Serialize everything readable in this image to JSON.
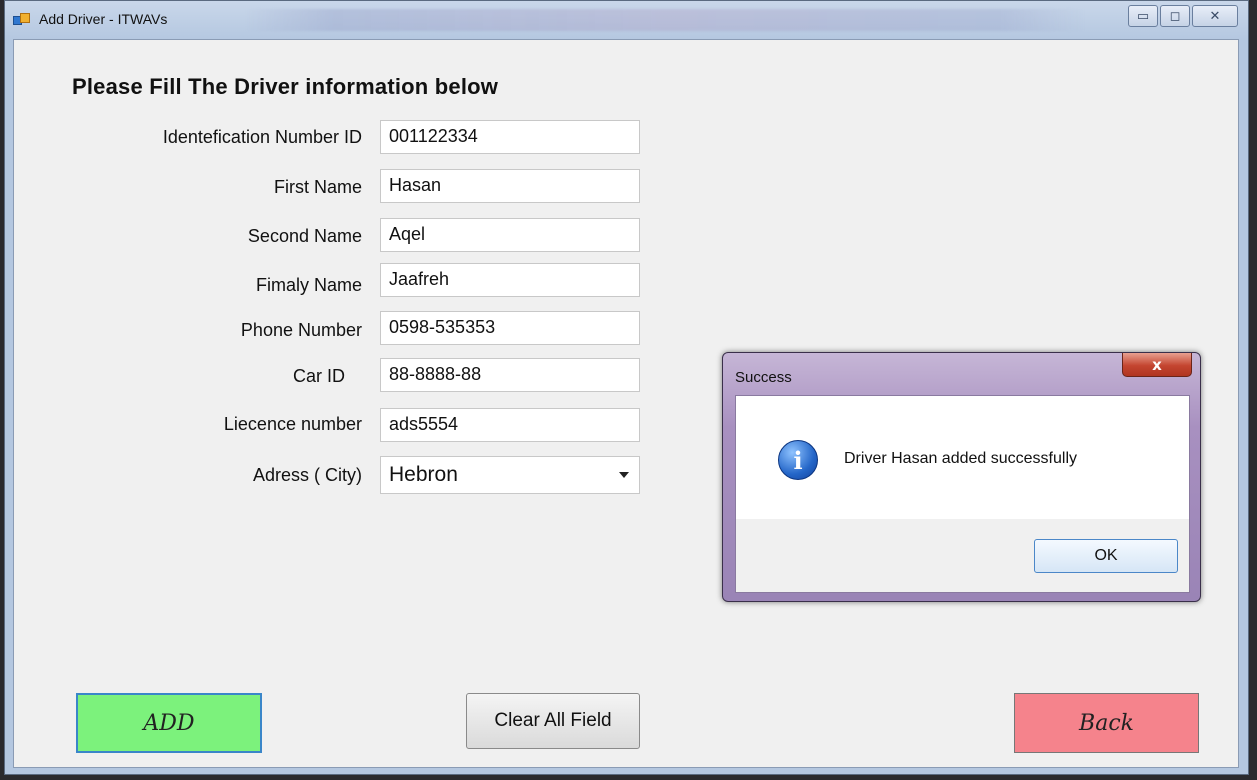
{
  "window": {
    "title": "Add Driver - ITWAVs",
    "controls": {
      "minimize": "▭",
      "maximize": "◻",
      "close": "✕"
    }
  },
  "form": {
    "heading": "Please Fill The Driver  information below",
    "fields": [
      {
        "label": "Identefication Number ID",
        "value": "001122334"
      },
      {
        "label": "First Name",
        "value": "Hasan"
      },
      {
        "label": "Second Name",
        "value": "Aqel"
      },
      {
        "label": "Fimaly Name",
        "value": "Jaafreh"
      },
      {
        "label": "Phone Number",
        "value": "0598-535353"
      },
      {
        "label": "Car ID",
        "value": "88-8888-88"
      },
      {
        "label": "Liecence number",
        "value": "ads5554"
      }
    ],
    "city": {
      "label": "Adress ( City)",
      "value": "Hebron"
    }
  },
  "buttons": {
    "add": "ADD",
    "clear": "Clear All Field",
    "back": "Back"
  },
  "dialog": {
    "title": "Success",
    "close_glyph": "x",
    "icon_glyph": "i",
    "message": "Driver Hasan added successfully",
    "ok": "OK"
  },
  "colors": {
    "add_button": "#7cf27c",
    "back_button": "#f5838c"
  }
}
